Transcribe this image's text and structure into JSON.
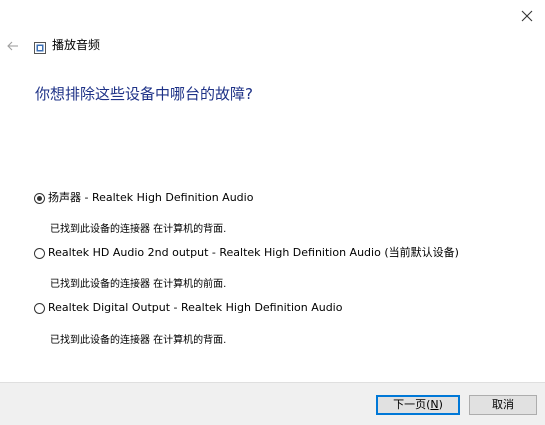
{
  "window": {
    "title": "播放音频",
    "close_glyph": "✕",
    "back_glyph": "←"
  },
  "question": "你想排除这些设备中哪台的故障?",
  "devices": [
    {
      "label": "扬声器 - Realtek High Definition Audio",
      "desc": "已找到此设备的连接器 在计算机的背面.",
      "selected": true
    },
    {
      "label": "Realtek HD Audio 2nd output - Realtek High Definition Audio (当前默认设备)",
      "desc": "已找到此设备的连接器 在计算机的前面.",
      "selected": false
    },
    {
      "label": "Realtek Digital Output - Realtek High Definition Audio",
      "desc": "已找到此设备的连接器 在计算机的背面.",
      "selected": false
    }
  ],
  "footer": {
    "next_label": "下一页(",
    "next_mnemonic": "N",
    "next_suffix": ")",
    "cancel_label": "取消"
  },
  "colors": {
    "question_text": "#1e3287",
    "primary_border": "#0078d7",
    "footer_bg": "#f0f0f0"
  }
}
